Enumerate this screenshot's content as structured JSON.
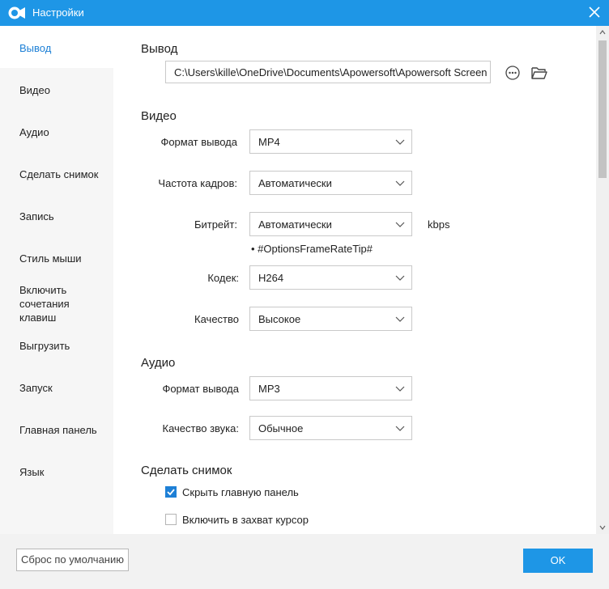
{
  "window": {
    "title": "Настройки"
  },
  "sidebar": {
    "items": [
      {
        "label": "Вывод",
        "active": true
      },
      {
        "label": "Видео"
      },
      {
        "label": "Аудио"
      },
      {
        "label": "Сделать снимок"
      },
      {
        "label": "Запись"
      },
      {
        "label": "Стиль мыши"
      },
      {
        "label": "Включить сочетания клавиш"
      },
      {
        "label": "Выгрузить"
      },
      {
        "label": "Запуск"
      },
      {
        "label": "Главная панель"
      },
      {
        "label": "Язык"
      }
    ]
  },
  "output": {
    "title": "Вывод",
    "path": "C:\\Users\\kille\\OneDrive\\Documents\\Apowersoft\\Apowersoft Screen R"
  },
  "video": {
    "title": "Видео",
    "format_label": "Формат вывода",
    "format_value": "MP4",
    "framerate_label": "Частота кадров:",
    "framerate_value": "Автоматически",
    "bitrate_label": "Битрейт:",
    "bitrate_value": "Автоматически",
    "bitrate_unit": "kbps",
    "tip": "• #OptionsFrameRateTip#",
    "codec_label": "Кодек:",
    "codec_value": "H264",
    "quality_label": "Качество",
    "quality_value": "Высокое"
  },
  "audio": {
    "title": "Аудио",
    "format_label": "Формат вывода",
    "format_value": "MP3",
    "quality_label": "Качество звука:",
    "quality_value": "Обычное"
  },
  "snapshot": {
    "title": "Сделать снимок",
    "hide_panel_label": "Скрыть главную панель",
    "hide_panel_checked": true,
    "include_cursor_label": "Включить в захват курсор",
    "include_cursor_checked": false
  },
  "footer": {
    "reset_label": "Сброс по умолчанию",
    "ok_label": "OK"
  },
  "colors": {
    "accent": "#1e96e6",
    "active_text": "#1e80d6"
  }
}
